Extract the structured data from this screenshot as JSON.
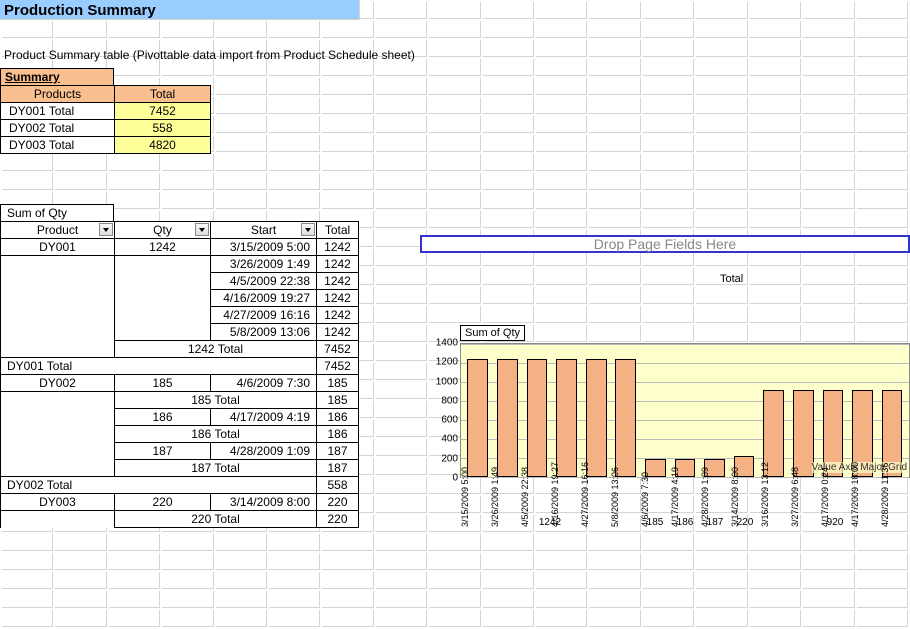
{
  "title": "Production Summary",
  "subtitle": "Product Summary table (Pivottable data import from Product Schedule sheet)",
  "summary": {
    "header": "Summary",
    "col_products": "Products",
    "col_total": "Total",
    "rows": [
      {
        "label": "DY001 Total",
        "value": "7452"
      },
      {
        "label": "DY002 Total",
        "value": "558"
      },
      {
        "label": "DY003 Total",
        "value": "4820"
      }
    ]
  },
  "pivot": {
    "measure": "Sum of Qty",
    "cols": {
      "product": "Product",
      "qty": "Qty",
      "start": "Start",
      "total": "Total"
    },
    "rows": [
      {
        "product": "DY001",
        "qty": "1242",
        "start": "3/15/2009 5:00",
        "total": "1242"
      },
      {
        "product": "",
        "qty": "",
        "start": "3/26/2009 1:49",
        "total": "1242"
      },
      {
        "product": "",
        "qty": "",
        "start": "4/5/2009 22:38",
        "total": "1242"
      },
      {
        "product": "",
        "qty": "",
        "start": "4/16/2009 19:27",
        "total": "1242"
      },
      {
        "product": "",
        "qty": "",
        "start": "4/27/2009 16:16",
        "total": "1242"
      },
      {
        "product": "",
        "qty": "",
        "start": "5/8/2009 13:06",
        "total": "1242"
      },
      {
        "product": "",
        "qty": "1242 Total",
        "start": "",
        "total": "7452"
      },
      {
        "product": "DY001 Total",
        "qty": "",
        "start": "",
        "total": "7452"
      },
      {
        "product": "DY002",
        "qty": "185",
        "start": "4/6/2009 7:30",
        "total": "185"
      },
      {
        "product": "",
        "qty": "185 Total",
        "start": "",
        "total": "185"
      },
      {
        "product": "",
        "qty": "186",
        "start": "4/17/2009 4:19",
        "total": "186"
      },
      {
        "product": "",
        "qty": "186 Total",
        "start": "",
        "total": "186"
      },
      {
        "product": "",
        "qty": "187",
        "start": "4/28/2009 1:09",
        "total": "187"
      },
      {
        "product": "",
        "qty": "187 Total",
        "start": "",
        "total": "187"
      },
      {
        "product": "DY002 Total",
        "qty": "",
        "start": "",
        "total": "558"
      },
      {
        "product": "DY003",
        "qty": "220",
        "start": "3/14/2009 8:00",
        "total": "220"
      },
      {
        "product": "",
        "qty": "220 Total",
        "start": "",
        "total": "220"
      }
    ]
  },
  "chart_zone": {
    "drop_hint": "Drop Page Fields Here",
    "legend": "Total",
    "chart_title": "Sum of Qty",
    "grid_annot": "Value Axis Major Grid"
  },
  "chart_data": {
    "type": "bar",
    "ylabel": "",
    "ylim": [
      0,
      1400
    ],
    "yticks": [
      0,
      200,
      400,
      600,
      800,
      1000,
      1200,
      1400
    ],
    "categories": [
      "3/15/2009 5:00",
      "3/26/2009 1:49",
      "4/5/2009 22:38",
      "4/16/2009 19:27",
      "4/27/2009 16:16",
      "5/8/2009 13:06",
      "4/6/2009 7:30",
      "4/17/2009 4:19",
      "4/28/2009 1:09",
      "3/14/2009 8:00",
      "3/16/2009 13:12",
      "3/27/2009 6:48",
      "4/17/2009 0:24",
      "4/17/2009 18:00",
      "4/28/2009 11:36"
    ],
    "values": [
      1242,
      1242,
      1242,
      1242,
      1242,
      1242,
      185,
      186,
      187,
      220,
      920,
      920,
      920,
      920,
      920
    ],
    "group_labels": [
      {
        "label": "1242",
        "span": 6
      },
      {
        "label": "185",
        "span": 1
      },
      {
        "label": "186",
        "span": 1
      },
      {
        "label": "187",
        "span": 1
      },
      {
        "label": "220",
        "span": 1
      },
      {
        "label": "920",
        "span": 5
      }
    ]
  }
}
